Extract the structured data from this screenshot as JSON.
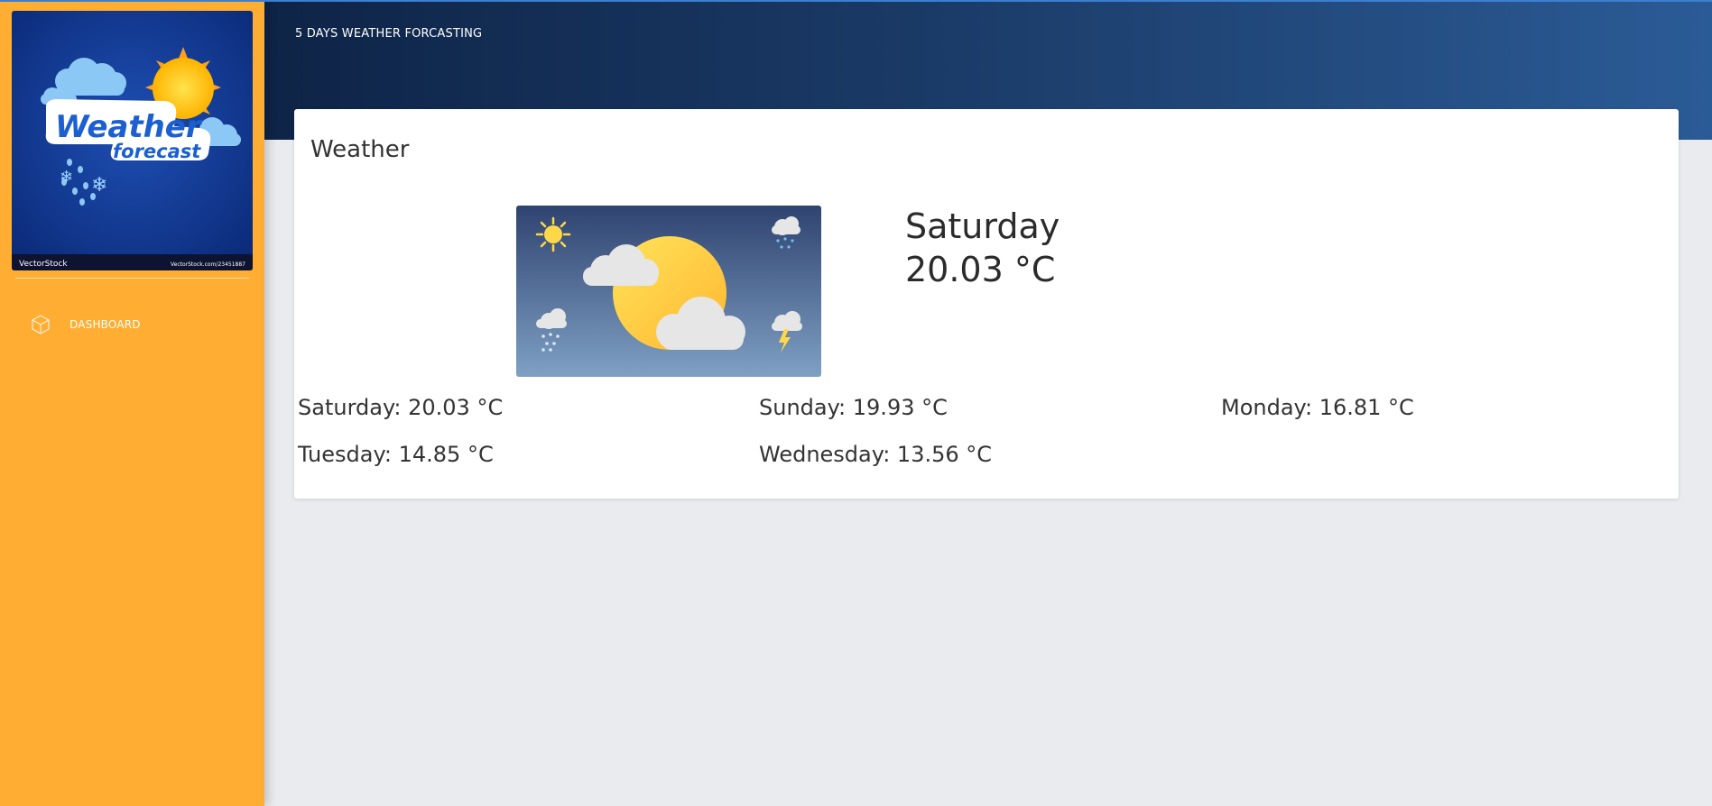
{
  "sidebar": {
    "logo": {
      "headline": "Weather",
      "subline": "forecast",
      "brand": "VectorStock",
      "brand_url": "VectorStock.com/23451887"
    },
    "nav": [
      {
        "label": "DASHBOARD",
        "icon": "cube-icon"
      }
    ]
  },
  "header": {
    "title": "5 DAYS WEATHER FORCASTING"
  },
  "card": {
    "title": "Weather",
    "today": {
      "day": "Saturday",
      "temp": "20.03 °C"
    },
    "forecast": [
      "Saturday: 20.03 °C",
      "Sunday: 19.93 °C",
      "Monday: 16.81 °C",
      "Tuesday: 14.85 °C",
      "Wednesday: 13.56 °C"
    ]
  },
  "colors": {
    "sidebar": "#ffae33",
    "header_dark": "#0e2447",
    "header_light": "#2b5b96",
    "page_bg": "#eaebee",
    "card_bg": "#ffffff"
  }
}
